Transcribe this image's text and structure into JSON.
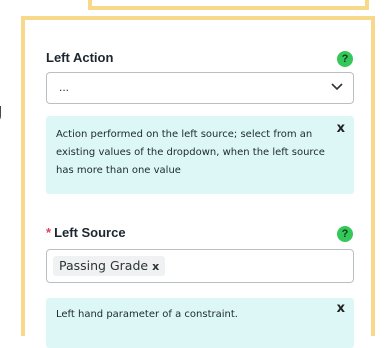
{
  "background": {
    "fragment_text": "g"
  },
  "left_action": {
    "label": "Left Action",
    "help_glyph": "?",
    "selected_value": "...",
    "info": {
      "text": "Action performed on the left source; select from an existing values of the dropdown, when the left source has more than one value",
      "close_glyph": "x"
    }
  },
  "left_source": {
    "required_marker": "*",
    "label": "Left Source",
    "help_glyph": "?",
    "chips": [
      {
        "label": "Passing Grade",
        "remove_glyph": "x"
      }
    ],
    "info": {
      "text": "Left hand parameter of a constraint.",
      "close_glyph": "x"
    }
  },
  "colors": {
    "panel_border": "#f8d98a",
    "info_background": "#ddf7f7",
    "help_icon": "#34c759",
    "required": "#e0435a"
  }
}
